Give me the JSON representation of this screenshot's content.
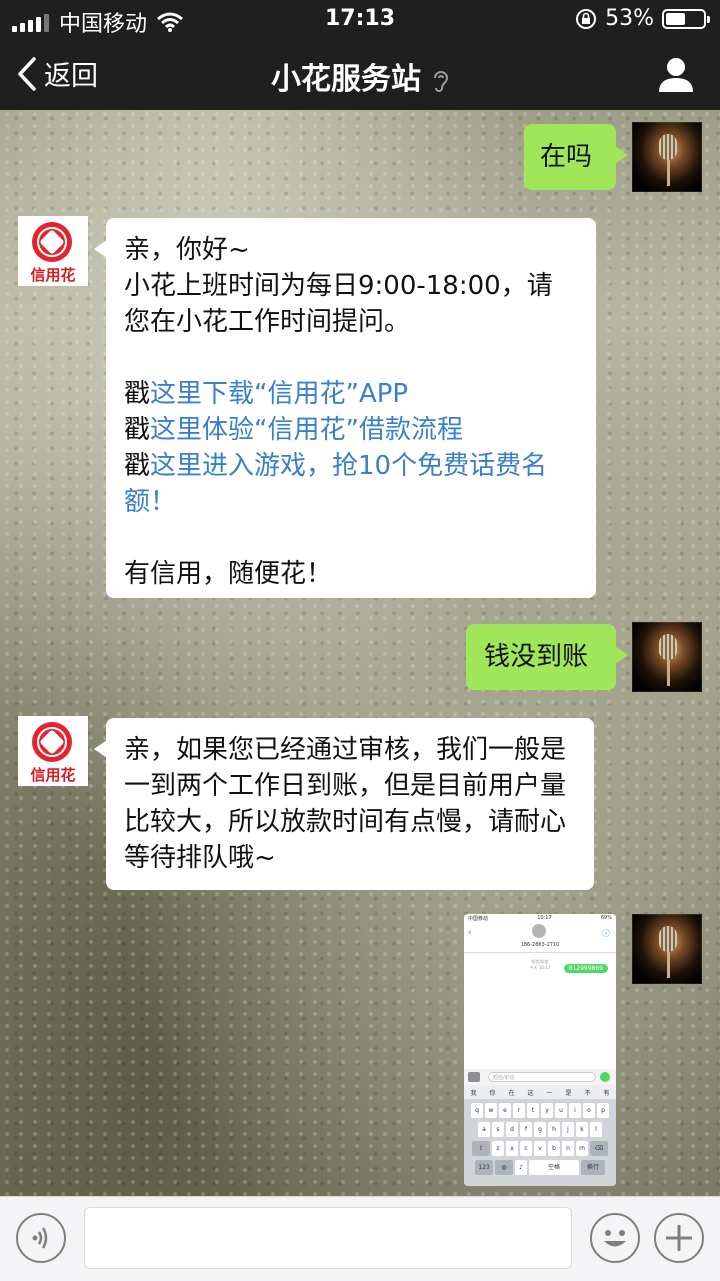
{
  "status_bar": {
    "carrier": "中国移动",
    "time": "17:13",
    "battery": "53%",
    "battery_level": 0.53
  },
  "nav": {
    "back_label": "返回",
    "title": "小花服务站"
  },
  "bot": {
    "logo_text": "信用花"
  },
  "messages": {
    "m1": "在吗",
    "m2": {
      "line1": "亲，你好~",
      "line2": "小花上班时间为每日9:00-18:00，请您在小花工作时间提问。",
      "link1_prefix": "戳",
      "link1": "这里下载“信用花”APP",
      "link2_prefix": "戳",
      "link2": "这里体验“信用花”借款流程",
      "link3_prefix": "戳",
      "link3": "这里进入游戏，抢10个免费话费名额！",
      "line_end": "有信用，随便花！"
    },
    "m3": "钱没到账",
    "m4": "亲，如果您已经通过审核，我们一般是一到两个工作日到账，但是目前用户量比较大，所以放款时间有点慢，请耐心等待排队哦~"
  },
  "screenshot": {
    "carrier": "中国移动",
    "time": "10:17",
    "battery": "69%",
    "phone": "186-2863-2710",
    "meta_line1": "短信/彩信",
    "meta_line2": "今天 10:17",
    "sms_text": "812999869",
    "input_placeholder": "短信/彩信",
    "candidates": [
      "我",
      "你",
      "在",
      "这",
      "一",
      "是",
      "不",
      "有"
    ],
    "row1": [
      "q",
      "w",
      "e",
      "r",
      "t",
      "y",
      "u",
      "i",
      "o",
      "p"
    ],
    "row2": [
      "a",
      "s",
      "d",
      "f",
      "g",
      "h",
      "j",
      "k",
      "l"
    ],
    "row3": [
      "z",
      "x",
      "c",
      "v",
      "b",
      "n",
      "m"
    ],
    "key_123": "123",
    "key_space": "空格",
    "key_return": "换行"
  },
  "colors": {
    "bar_bg": "#1f1f1f",
    "sent_bubble": "#9fe658",
    "link": "#3a7fcc",
    "logo_red": "#e1242d"
  },
  "icons": [
    "back-chevron-icon",
    "ear-icon",
    "profile-icon",
    "wifi-icon",
    "lock-rotation-icon",
    "voice-icon",
    "emoji-icon",
    "plus-icon"
  ]
}
